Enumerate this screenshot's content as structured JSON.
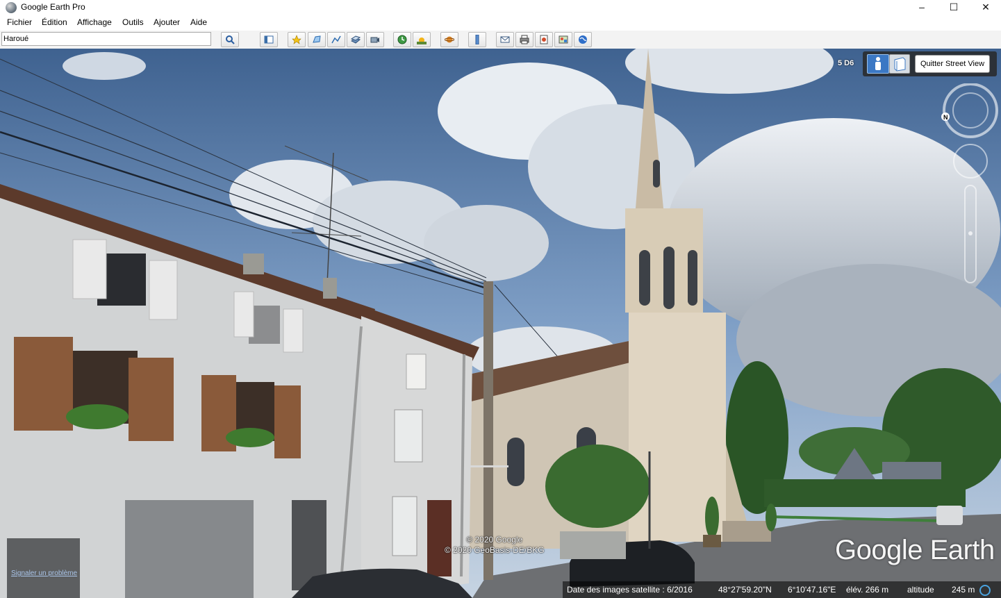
{
  "window": {
    "title": "Google Earth Pro",
    "minimize": "–",
    "maximize": "☐",
    "close": "✕"
  },
  "menu": [
    "Fichier",
    "Édition",
    "Affichage",
    "Outils",
    "Ajouter",
    "Aide"
  ],
  "search": {
    "value": "Haroué"
  },
  "toolbar_icons": [
    "search-icon",
    "sidebar-icon",
    "placemark-icon",
    "polygon-icon",
    "path-icon",
    "image-overlay-icon",
    "tour-icon",
    "historical-imagery-icon",
    "sunlight-icon",
    "planets-icon",
    "ruler-icon",
    "email-icon",
    "print-icon",
    "save-image-icon",
    "map-icon",
    "view-in-maps-icon"
  ],
  "streetview": {
    "level": "5 D6",
    "quit_label": "Quitter Street View"
  },
  "compass": {
    "north": "N"
  },
  "copyright": {
    "line1": "© 2020 Google",
    "line2": "© 2020 GeoBasis-DE/BKG"
  },
  "report_link": "Signaler un problème",
  "logo": "Google Earth",
  "status": {
    "imagery_date": "Date des images satellite : 6/2016",
    "lat": "48°27'59.20\"N",
    "lon": "6°10'47.16\"E",
    "elev": "élév.  266 m",
    "altitude_label": "altitude",
    "altitude_value": "245 m"
  },
  "colors": {
    "sky": "#7fa0c4",
    "highlight": "#3b78c4"
  }
}
